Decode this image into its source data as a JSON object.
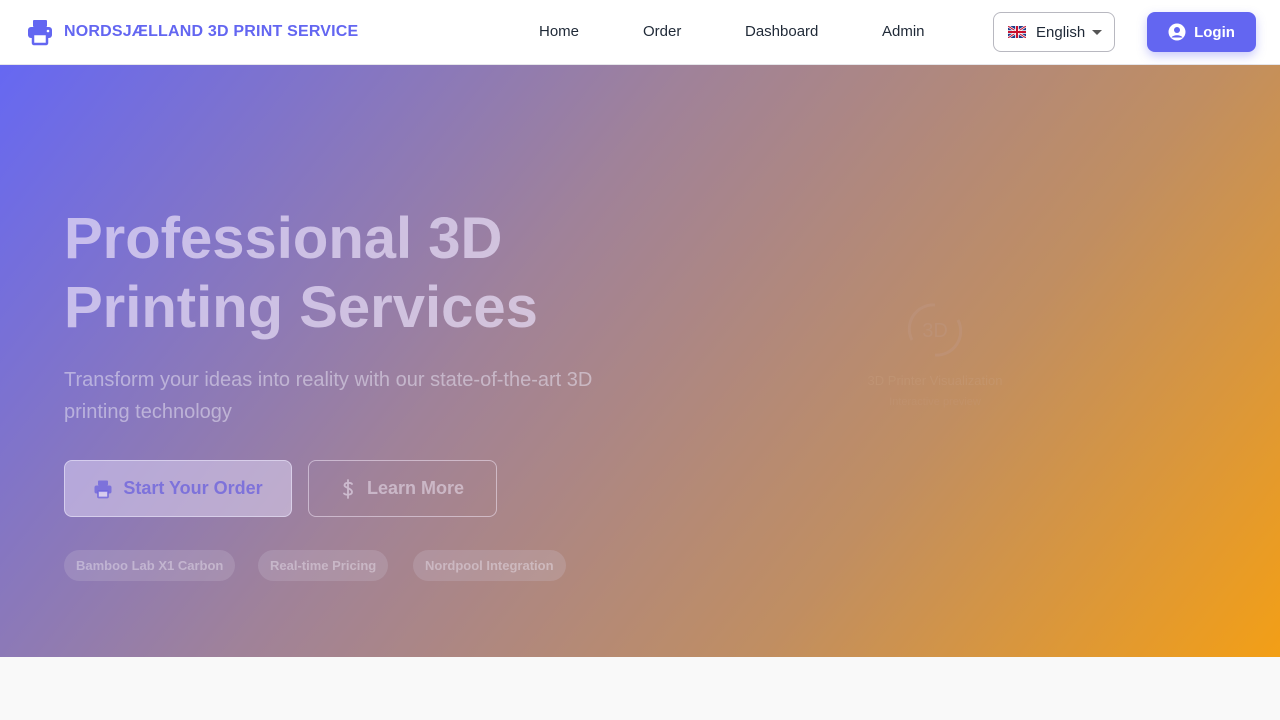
{
  "brand": {
    "name": "NORDSJÆLLAND 3D PRINT SERVICE",
    "icon": "printer-icon",
    "color": "#6366f1"
  },
  "nav": {
    "items": [
      {
        "label": "Home"
      },
      {
        "label": "Order"
      },
      {
        "label": "Dashboard"
      },
      {
        "label": "Admin"
      }
    ],
    "language": {
      "label": "English",
      "flag": "uk-flag-icon"
    },
    "login": {
      "label": "Login",
      "icon": "user-circle-icon"
    }
  },
  "hero": {
    "title": "Professional 3D Printing Services",
    "subtitle": "Transform your ideas into reality with our state-of-the-art 3D printing technology",
    "primary_cta": {
      "label": "Start Your Order",
      "icon": "printer-icon"
    },
    "secondary_cta": {
      "label": "Learn More",
      "icon": "dollar-icon"
    },
    "badges": [
      "Bamboo Lab X1 Carbon",
      "Real-time Pricing",
      "Nordpool Integration"
    ],
    "visual": {
      "title": "3D Printer Visualization",
      "subtitle": "Interactive preview",
      "icon": "rotate-3d-icon"
    }
  },
  "colors": {
    "accent": "#6366f1",
    "gradient_start": "#6668f2",
    "gradient_end": "#f39f16"
  }
}
